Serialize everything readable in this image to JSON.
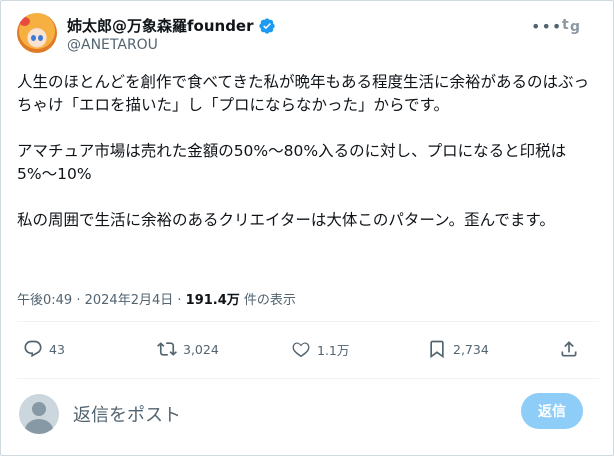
{
  "author": {
    "display_name": "姉太郎@万象森羅founder",
    "handle": "@ANETAROU",
    "verified": true
  },
  "header_icons": [
    "more-icon",
    "tg-icon"
  ],
  "tweet": {
    "paragraphs": [
      "人生のほとんどを創作で食べてきた私が晩年もある程度生活に余裕があるのはぶっちゃけ「エロを描いた」し「プロにならなかった」からです。",
      "アマチュア市場は売れた金額の50%〜80%入るのに対し、プロになると印税は5%〜10%",
      "私の周囲で生活に余裕のあるクリエイターは大体このパターン。歪んでます。"
    ]
  },
  "meta": {
    "time": "午後0:49",
    "separator": " · ",
    "date": "2024年2月4日",
    "views": "191.4万",
    "views_label": " 件の表示"
  },
  "actions": {
    "reply_count": "43",
    "retweet_count": "3,024",
    "like_count": "1.1万",
    "bookmark_count": "2,734"
  },
  "composer": {
    "placeholder": "返信をポスト",
    "button_label": "返信"
  },
  "colors": {
    "accent": "#1d9bf0",
    "reply_button_disabled": "#8ecdf7",
    "secondary_text": "#536471"
  }
}
